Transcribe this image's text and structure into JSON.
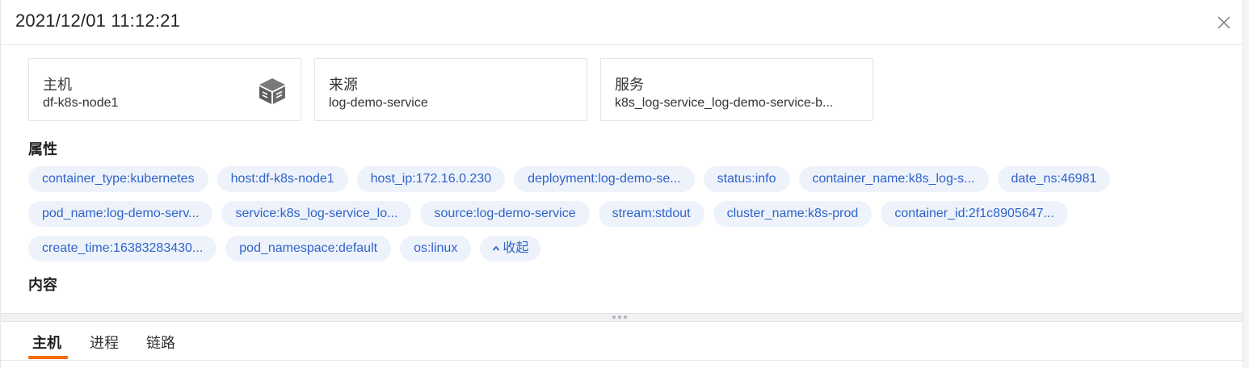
{
  "header": {
    "title": "2021/12/01 11:12:21"
  },
  "cards": [
    {
      "label": "主机",
      "value": "df-k8s-node1",
      "icon": "host-cube-icon"
    },
    {
      "label": "来源",
      "value": "log-demo-service"
    },
    {
      "label": "服务",
      "value": "k8s_log-service_log-demo-service-b..."
    }
  ],
  "attributes": {
    "heading": "属性",
    "row1": [
      "container_type:kubernetes",
      "host:df-k8s-node1",
      "host_ip:172.16.0.230",
      "deployment:log-demo-se...",
      "status:info",
      "container_name:k8s_log-s...",
      "date_ns:46981"
    ],
    "row2": [
      "pod_name:log-demo-serv...",
      "service:k8s_log-service_lo...",
      "source:log-demo-service",
      "stream:stdout",
      "cluster_name:k8s-prod",
      "container_id:2f1c8905647..."
    ],
    "row3": [
      "create_time:16383283430...",
      "pod_namespace:default",
      "os:linux"
    ],
    "collapse_label": "收起"
  },
  "content": {
    "heading": "内容"
  },
  "tabs": [
    {
      "label": "主机",
      "active": true
    },
    {
      "label": "进程",
      "active": false
    },
    {
      "label": "链路",
      "active": false
    }
  ],
  "colors": {
    "tag_bg": "#eef3fb",
    "tag_text": "#2f63c9",
    "tab_accent": "#f26a10"
  }
}
